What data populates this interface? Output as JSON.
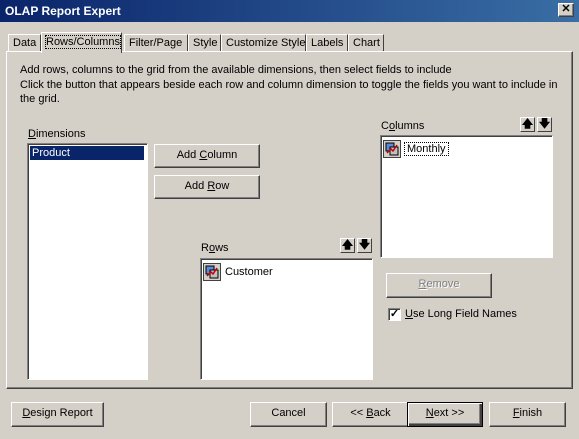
{
  "window": {
    "title": "OLAP Report Expert",
    "close_symbol": "✕"
  },
  "tabs": [
    {
      "label": "Data"
    },
    {
      "label": "Rows/Columns"
    },
    {
      "label": "Filter/Page"
    },
    {
      "label": "Style"
    },
    {
      "label": "Customize Style"
    },
    {
      "label": "Labels"
    },
    {
      "label": "Chart"
    }
  ],
  "instructions": {
    "line1": "Add rows, columns to the grid from the available dimensions, then select fields to include",
    "line2": "Click the button that appears beside each row and column dimension to toggle the fields you want to include in",
    "line3": "the grid."
  },
  "dimensions": {
    "label_prefix": "D",
    "label_rest": "imensions",
    "items": [
      "Product"
    ]
  },
  "buttons": {
    "add_column_pre": "Add ",
    "add_column_u": "C",
    "add_column_post": "olumn",
    "add_row_pre": "Add ",
    "add_row_u": "R",
    "add_row_post": "ow",
    "remove_u": "R",
    "remove_post": "emove",
    "design_report_pre": "",
    "design_report_u": "D",
    "design_report_post": "esign Report",
    "cancel": "Cancel",
    "back_pre": "<< ",
    "back_u": "B",
    "back_post": "ack",
    "next_pre": "",
    "next_u": "N",
    "next_post": "ext >>",
    "finish_pre": "",
    "finish_u": "F",
    "finish_post": "inish"
  },
  "columns": {
    "label_pre": "C",
    "label_u": "o",
    "label_post": "lumns",
    "items": [
      "Monthly"
    ]
  },
  "rows": {
    "label_pre": "R",
    "label_u": "o",
    "label_post": "ws",
    "items": [
      "Customer"
    ]
  },
  "arrows": {
    "up": "🡅",
    "down": "🡇"
  },
  "use_long_field_names": {
    "checked": "✓",
    "label_u": "U",
    "label_post": "se Long Field Names"
  }
}
